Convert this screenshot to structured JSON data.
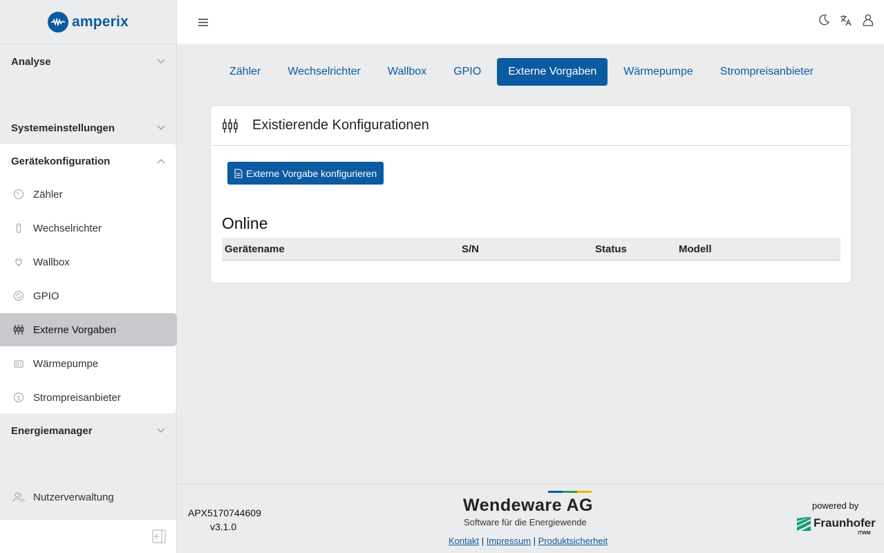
{
  "brand": {
    "name": "amperix",
    "color": "#0b5aa2"
  },
  "sidebar": {
    "sections": [
      {
        "label": "Analyse"
      },
      {
        "label": "Systemeinstellungen"
      },
      {
        "label": "Gerätekonfiguration"
      },
      {
        "label": "Energiemanager"
      }
    ],
    "items": [
      {
        "label": "Zähler",
        "icon": "gauge-icon"
      },
      {
        "label": "Wechselrichter",
        "icon": "inverter-icon"
      },
      {
        "label": "Wallbox",
        "icon": "plug-icon"
      },
      {
        "label": "GPIO",
        "icon": "gpio-icon"
      },
      {
        "label": "Externe Vorgaben",
        "icon": "sliders-icon",
        "active": true
      },
      {
        "label": "Wärmepumpe",
        "icon": "heatpump-icon"
      },
      {
        "label": "Strompreisanbieter",
        "icon": "dollar-icon"
      }
    ],
    "user_admin": {
      "label": "Nutzerverwaltung",
      "icon": "users-icon"
    }
  },
  "tabs": [
    {
      "label": "Zähler"
    },
    {
      "label": "Wechselrichter"
    },
    {
      "label": "Wallbox"
    },
    {
      "label": "GPIO"
    },
    {
      "label": "Externe Vorgaben",
      "active": true
    },
    {
      "label": "Wärmepumpe"
    },
    {
      "label": "Strompreisanbieter"
    }
  ],
  "card": {
    "title": "Existierende Konfigurationen",
    "button_label": "Externe Vorgabe konfigurieren",
    "section_title": "Online",
    "columns": [
      "Gerätename",
      "S/N",
      "Status",
      "Modell"
    ],
    "rows": []
  },
  "footer": {
    "serial": "APX5170744609",
    "version": "v3.1.0",
    "company": "Wendeware AG",
    "tagline": "Software für die Energiewende",
    "links": [
      "Kontakt",
      "Impressum",
      "Produktsicherheit"
    ],
    "separator": "|",
    "powered_by": "powered by",
    "partner": "Fraunhofer",
    "partner_sub": "ITWM",
    "bar_colors": [
      "#0b5aa2",
      "#2e9e4f",
      "#f0b400"
    ]
  }
}
